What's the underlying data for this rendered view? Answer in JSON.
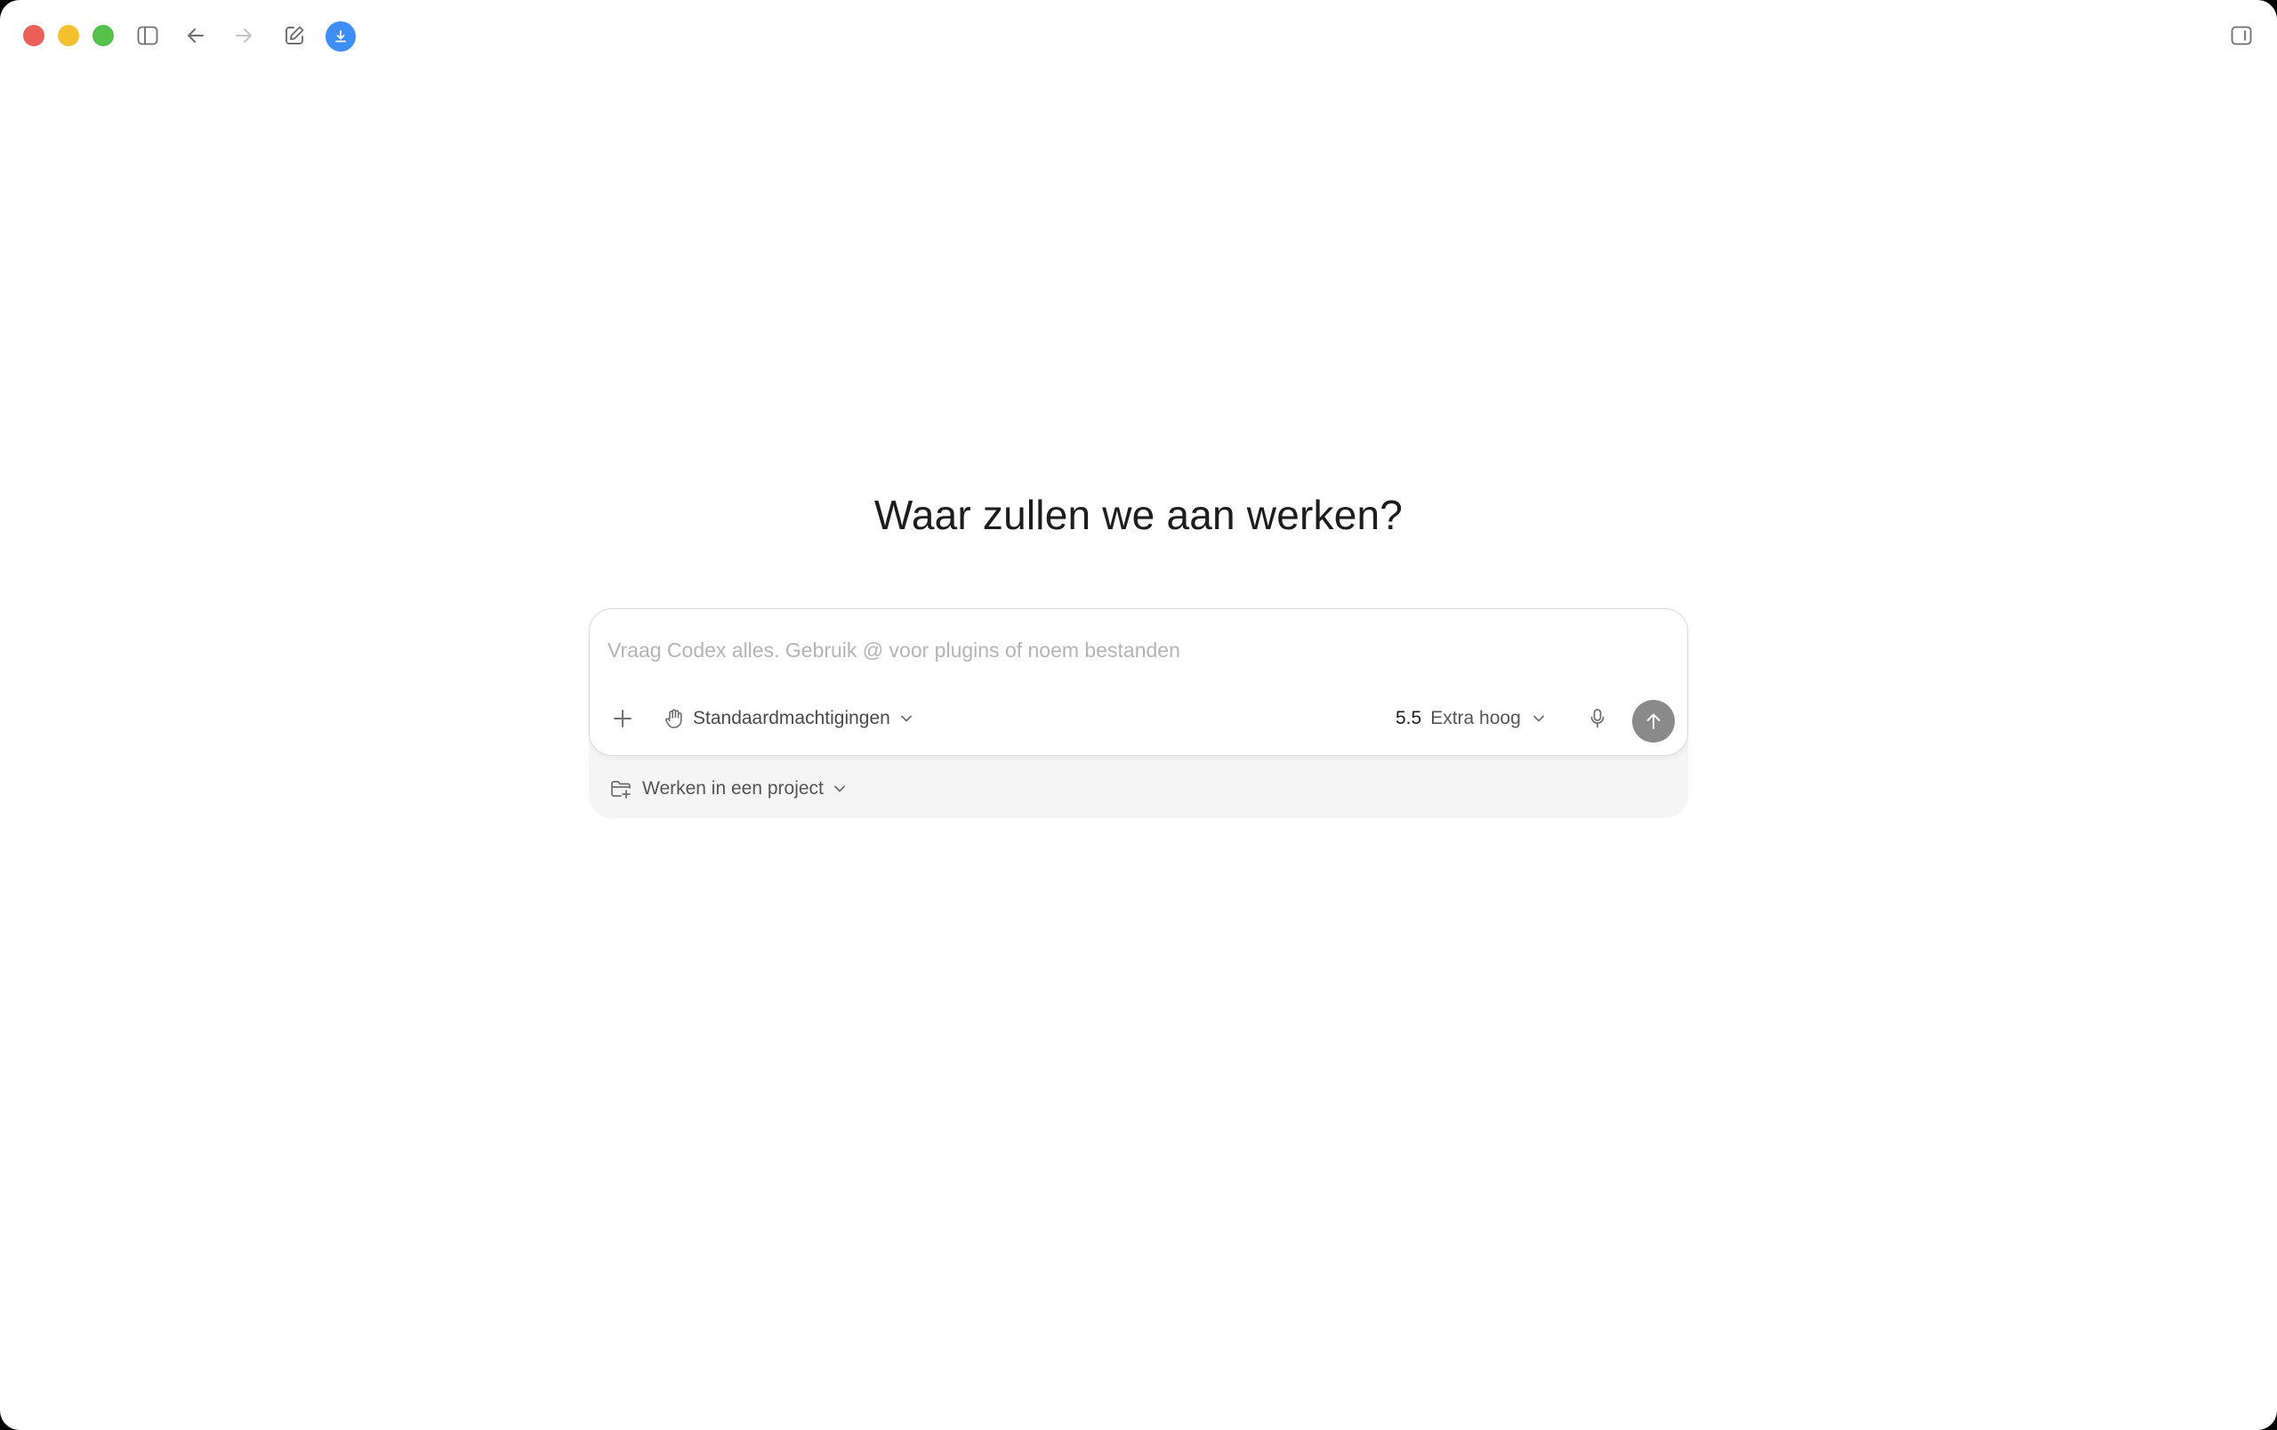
{
  "window": {
    "traffic_lights": {
      "close_color": "#ec5f57",
      "minimize_color": "#f4c02f",
      "maximize_color": "#55c04a"
    },
    "toolbar": {
      "sidebar_toggle_icon": "sidebar-icon",
      "back_icon": "arrow-left-icon",
      "forward_icon": "arrow-right-icon",
      "new_chat_icon": "compose-icon",
      "download_icon": "download-icon",
      "download_color": "#3d8ef7",
      "right_panel_icon": "panel-icon"
    }
  },
  "main": {
    "heading": "Waar zullen we aan werken?"
  },
  "composer": {
    "placeholder": "Vraag Codex alles. Gebruik @ voor plugins of noem bestanden",
    "value": "",
    "permissions_label": "Standaardmachtigingen",
    "model_version": "5.5",
    "model_effort": "Extra hoog",
    "send_color": "#8a8a8a",
    "project_label": "Werken in een project"
  }
}
